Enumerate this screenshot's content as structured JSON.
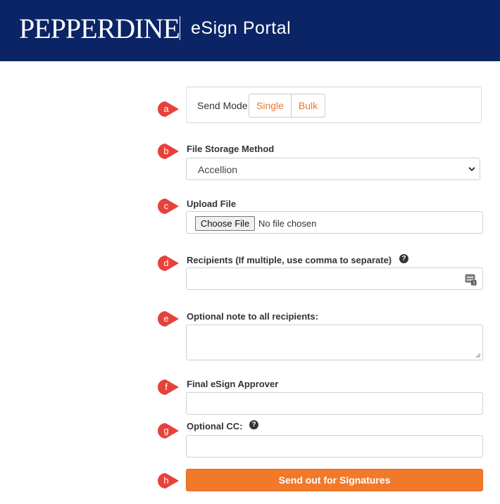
{
  "header": {
    "logo_text": "PEPPERDINE",
    "title": "eSign Portal",
    "background_color": "#0b2466"
  },
  "send_mode": {
    "label": "Send Mode:",
    "options": [
      "Single",
      "Bulk"
    ]
  },
  "storage": {
    "label": "File Storage Method",
    "selected": "Accellion"
  },
  "upload": {
    "label": "Upload File",
    "button_label": "Choose File",
    "status": "No file chosen"
  },
  "recipients": {
    "label": "Recipients (If multiple, use comma to separate)",
    "value": ""
  },
  "note": {
    "label": "Optional note to all recipients:",
    "value": ""
  },
  "approver": {
    "label": "Final eSign Approver",
    "value": ""
  },
  "cc": {
    "label": "Optional CC:",
    "value": ""
  },
  "help_icon_glyph": "?",
  "submit": {
    "label": "Send out for Signatures",
    "color": "#f07a2a"
  },
  "markers": [
    "a",
    "b",
    "c",
    "d",
    "e",
    "f",
    "g",
    "h"
  ],
  "marker_color": "#e8413a",
  "icons": {
    "help": "help-icon",
    "contacts": "contacts-icon",
    "dropdown": "chevron-down-icon"
  }
}
